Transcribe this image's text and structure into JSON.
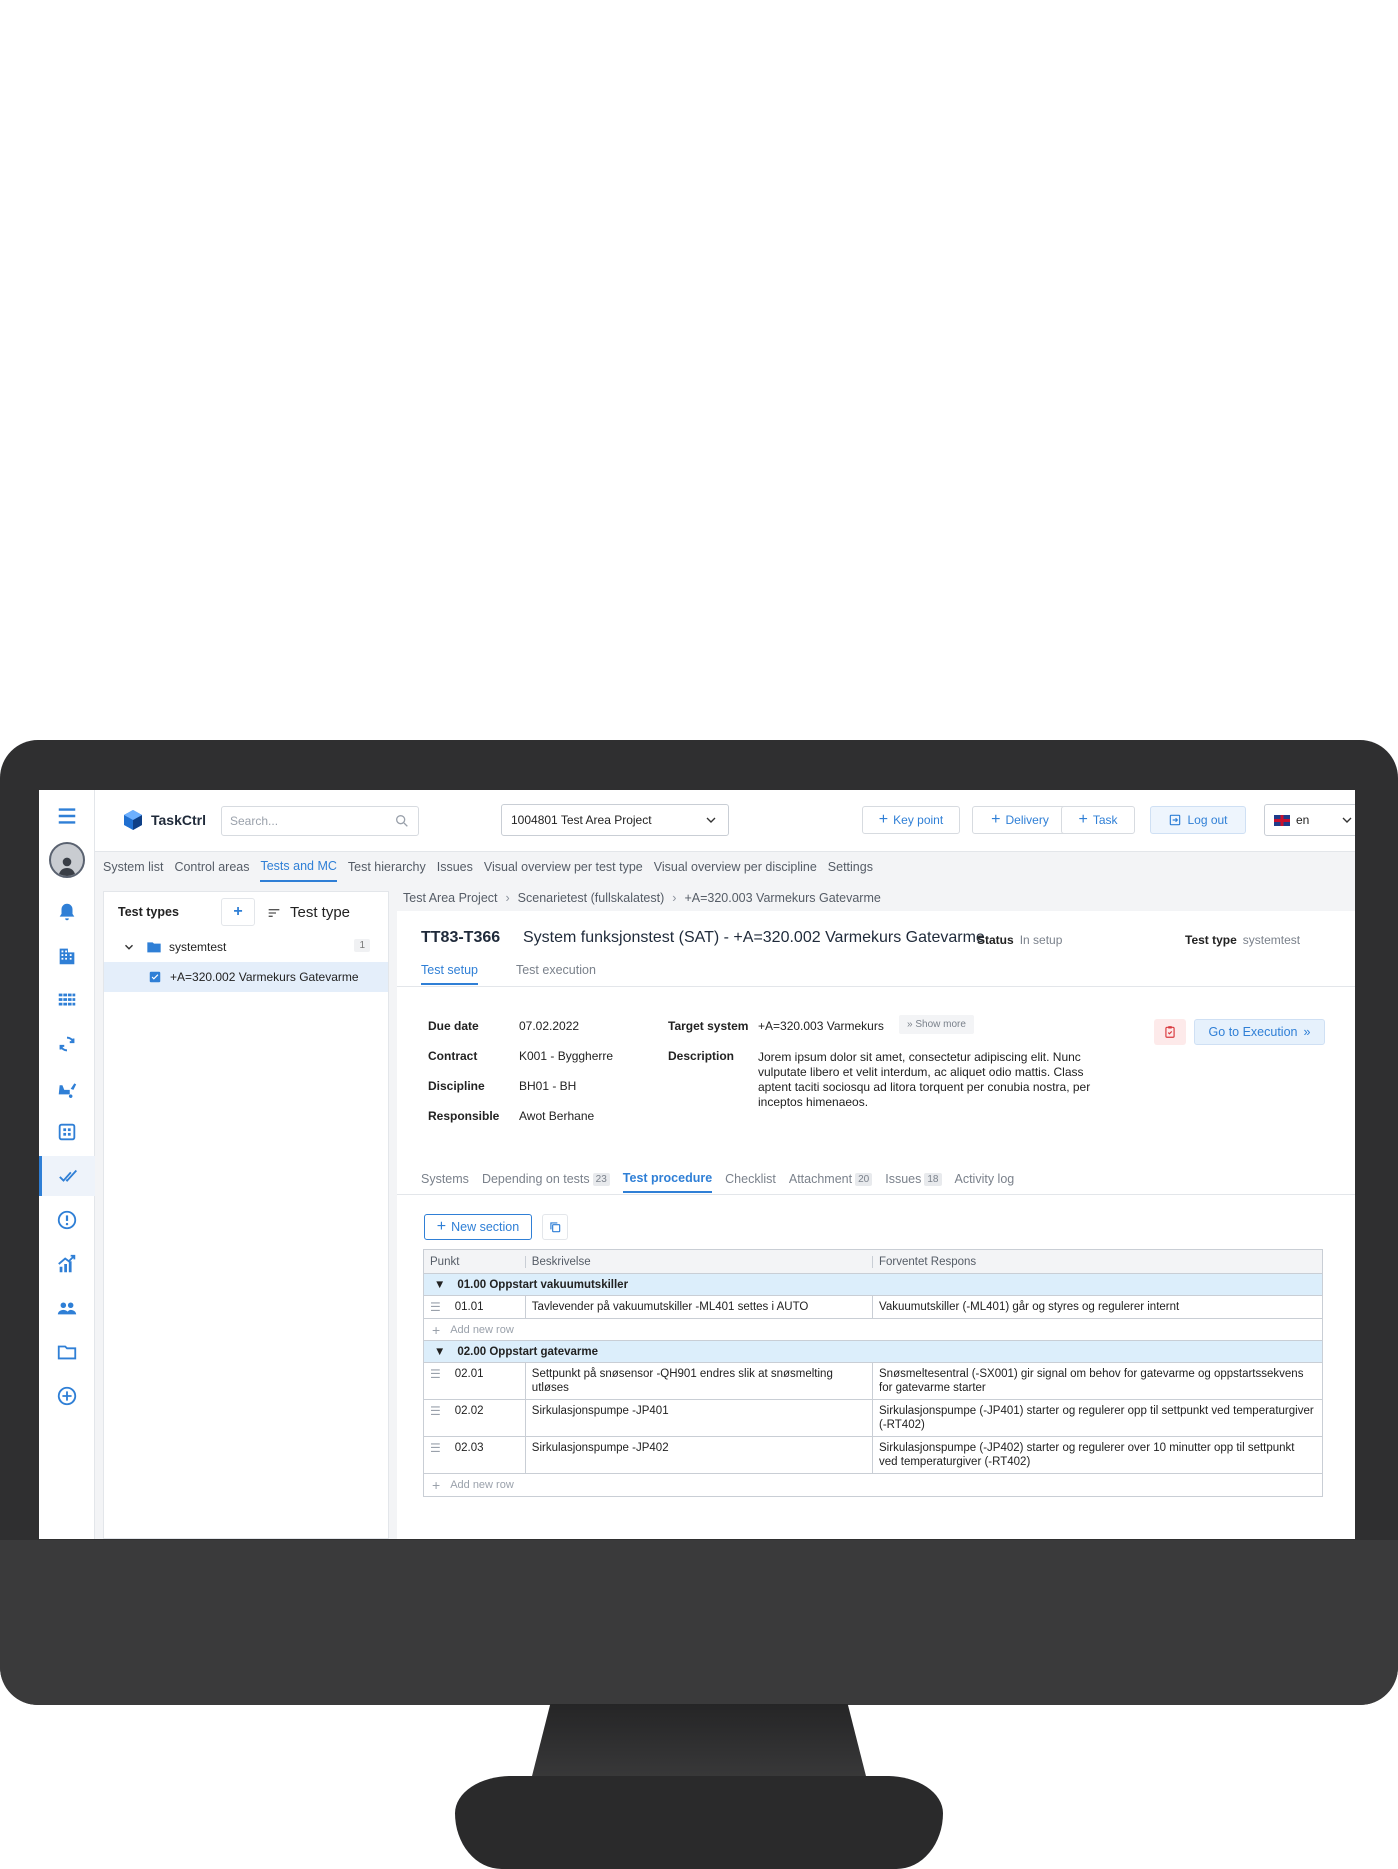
{
  "app": {
    "logo_text": "TaskCtrl"
  },
  "header": {
    "search_placeholder": "Search...",
    "project": "1004801 Test Area Project",
    "key_point": "Key point",
    "delivery": "Delivery",
    "task": "Task",
    "logout": "Log out",
    "language": "en"
  },
  "nav": {
    "items": [
      "System list",
      "Control areas",
      "Tests and MC",
      "Test hierarchy",
      "Issues",
      "Visual overview per test type",
      "Visual overview per discipline",
      "Settings"
    ],
    "active": "Tests and MC"
  },
  "left_panel": {
    "title": "Test types",
    "sort_label": "Test type",
    "tree": [
      {
        "label": "systemtest",
        "count": "1"
      },
      {
        "label": "+A=320.002 Varmekurs Gatevarme"
      }
    ]
  },
  "breadcrumb": [
    "Test Area Project",
    "Scenarietest (fullskalatest)",
    "+A=320.003 Varmekurs Gatevarme"
  ],
  "test": {
    "id": "TT83-T366",
    "title": "System funksjonstest (SAT) - +A=320.002 Varmekurs Gatevarme",
    "status_label": "Status",
    "status_value": "In setup",
    "type_label": "Test type",
    "type_value": "systemtest"
  },
  "tabs_top": [
    "Test setup",
    "Test execution"
  ],
  "fields": {
    "due_date_label": "Due date",
    "due_date": "07.02.2022",
    "contract_label": "Contract",
    "contract": "K001 - Byggherre",
    "discipline_label": "Discipline",
    "discipline": "BH01 - BH",
    "responsible_label": "Responsible",
    "responsible": "Awot Berhane",
    "target_system_label": "Target system",
    "target_system": "+A=320.003 Varmekurs",
    "show_more": "Show more",
    "description_label": "Description",
    "description": "Jorem ipsum dolor sit amet, consectetur adipiscing elit. Nunc vulputate libero et velit interdum, ac aliquet odio mattis. Class aptent taciti sociosqu ad litora torquent per conubia nostra, per inceptos himenaeos."
  },
  "go_to_execution": "Go to Execution",
  "tabs_bottom": {
    "systems": "Systems",
    "depending": "Depending on tests",
    "depending_count": "23",
    "procedure": "Test procedure",
    "checklist": "Checklist",
    "attachment": "Attachment",
    "attachment_count": "20",
    "issues": "Issues",
    "issues_count": "18",
    "activity": "Activity log"
  },
  "new_section": "New section",
  "procedure": {
    "columns": [
      "Punkt",
      "Beskrivelse",
      "Forventet Respons"
    ],
    "add_row": "Add new row",
    "sections": [
      {
        "title": "01.00 Oppstart vakuumutskiller",
        "rows": [
          {
            "punkt": "01.01",
            "beskrivelse": "Tavlevender på vakuumutskiller -ML401 settes i AUTO",
            "respons": "Vakuumutskiller (-ML401) går og styres og regulerer internt"
          }
        ]
      },
      {
        "title": "02.00 Oppstart gatevarme",
        "rows": [
          {
            "punkt": "02.01",
            "beskrivelse": "Settpunkt på snøsensor -QH901 endres slik at snøsmelting utløses",
            "respons": "Snøsmeltesentral (-SX001) gir signal om behov for gatevarme og oppstartssekvens for gatevarme starter"
          },
          {
            "punkt": "02.02",
            "beskrivelse": "Sirkulasjonspumpe -JP401",
            "respons": "Sirkulasjonspumpe (-JP401) starter og regulerer opp til settpunkt ved temperaturgiver (-RT402)"
          },
          {
            "punkt": "02.03",
            "beskrivelse": "Sirkulasjonspumpe -JP402",
            "respons": "Sirkulasjonspumpe (-JP402) starter og regulerer over 10 minutter opp til settpunkt ved temperaturgiver (-RT402)"
          }
        ]
      }
    ]
  },
  "colors": {
    "accent": "#2f7fd6",
    "section_bg": "#dceefb",
    "bezel": "#2f2f30"
  }
}
